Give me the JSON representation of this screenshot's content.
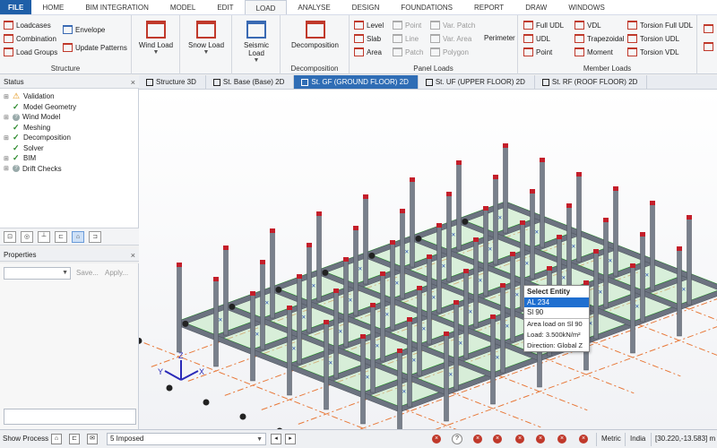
{
  "menu": {
    "tabs": [
      "FILE",
      "HOME",
      "BIM INTEGRATION",
      "MODEL",
      "EDIT",
      "LOAD",
      "ANALYSE",
      "DESIGN",
      "FOUNDATIONS",
      "REPORT",
      "DRAW",
      "WINDOWS"
    ],
    "active": "LOAD"
  },
  "ribbon": {
    "structure": {
      "label": "Structure",
      "loadcases": "Loadcases",
      "combination": "Combination",
      "load_groups": "Load Groups",
      "envelope": "Envelope",
      "update_patterns": "Update Patterns"
    },
    "wind_load": "Wind Load",
    "snow_load": "Snow Load",
    "seismic_load": "Seismic Load",
    "decomposition": {
      "button": "Decomposition",
      "label": "Decomposition"
    },
    "panel_loads": {
      "label": "Panel Loads",
      "level": "Level",
      "slab": "Slab",
      "area": "Area",
      "point": "Point",
      "line": "Line",
      "patch": "Patch",
      "var_patch": "Var. Patch",
      "var_area": "Var. Area",
      "polygon": "Polygon",
      "perimeter": "Perimeter"
    },
    "member_loads": {
      "label": "Member Loads",
      "full_udl": "Full UDL",
      "udl": "UDL",
      "point": "Point",
      "vdl": "VDL",
      "trapezoidal": "Trapezoidal",
      "moment": "Moment",
      "torsion_full_udl": "Torsion Full UDL",
      "torsion_udl": "Torsion UDL",
      "torsion_vdl": "Torsion VDL"
    }
  },
  "status_panel": {
    "title": "Status",
    "items": [
      {
        "label": "Validation",
        "state": "warning"
      },
      {
        "label": "Model Geometry",
        "state": "ok"
      },
      {
        "label": "Wind Model",
        "state": "unknown"
      },
      {
        "label": "Meshing",
        "state": "ok"
      },
      {
        "label": "Decomposition",
        "state": "ok"
      },
      {
        "label": "Solver",
        "state": "ok"
      },
      {
        "label": "BIM",
        "state": "ok"
      },
      {
        "label": "Drift Checks",
        "state": "unknown"
      }
    ]
  },
  "properties_panel": {
    "title": "Properties",
    "save": "Save...",
    "apply": "Apply..."
  },
  "doc_tabs": [
    {
      "label": "Structure 3D",
      "active": false
    },
    {
      "label": "St. Base (Base) 2D",
      "active": false
    },
    {
      "label": "St. GF (GROUND FLOOR) 2D",
      "active": true
    },
    {
      "label": "St. UF (UPPER FLOOR) 2D",
      "active": false
    },
    {
      "label": "St. RF (ROOF FLOOR) 2D",
      "active": false
    }
  ],
  "select_entity": {
    "title": "Select Entity",
    "options": [
      "AL 234",
      "Sl 90"
    ],
    "selected": "AL 234",
    "info": [
      "Area load on Sl 90",
      "Load: 3.500kN/m²",
      "Direction: Global Z"
    ]
  },
  "axes": {
    "x": "X",
    "y": "Y",
    "z": "Z"
  },
  "statusbar": {
    "show_process": "Show Process",
    "loadcase": "5 Imposed",
    "units": "Metric",
    "region": "India",
    "coords": "[30.220,-13.583] m"
  },
  "colors": {
    "accent": "#2f6db5",
    "slab_fill": "#bfe8bf",
    "slab_edge": "#22cc22",
    "member": "#6c7380",
    "column_cap": "#c41e2a"
  }
}
